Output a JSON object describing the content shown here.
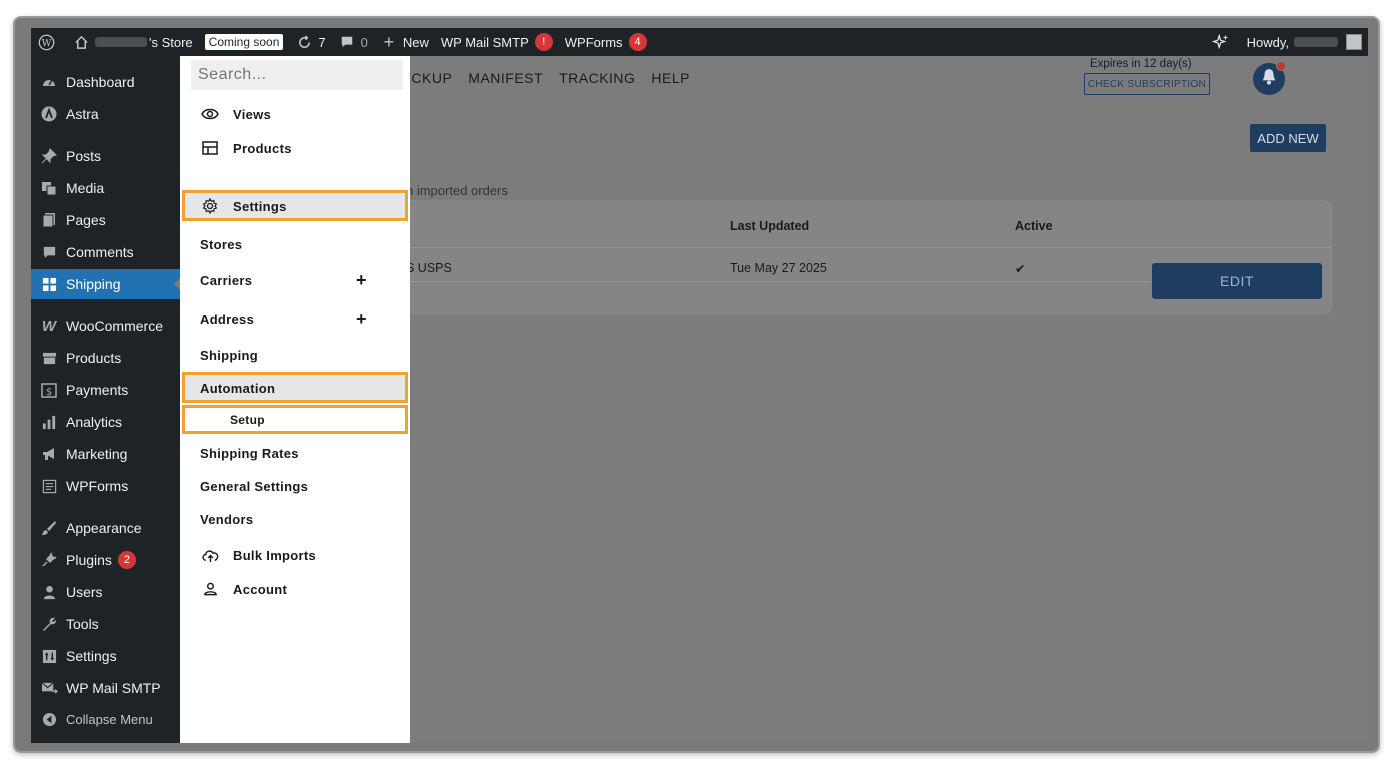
{
  "adminbar": {
    "store_suffix": "'s Store",
    "coming_soon": "Coming soon",
    "updates": "7",
    "comments": "0",
    "new": "New",
    "wp_mail_smtp": "WP Mail SMTP",
    "wp_mail_badge": "!",
    "wpforms": "WPForms",
    "wpforms_badge": "4",
    "howdy": "Howdy,"
  },
  "sidebar": {
    "items": [
      {
        "label": "Dashboard",
        "icon": "dashboard-icon"
      },
      {
        "label": "Astra",
        "icon": "astra-icon"
      },
      {
        "label": "Posts",
        "icon": "pin-icon"
      },
      {
        "label": "Media",
        "icon": "media-icon"
      },
      {
        "label": "Pages",
        "icon": "pages-icon"
      },
      {
        "label": "Comments",
        "icon": "comment-icon"
      },
      {
        "label": "Shipping",
        "icon": "grid-icon"
      },
      {
        "label": "WooCommerce",
        "icon": "woo-icon"
      },
      {
        "label": "Products",
        "icon": "archive-icon"
      },
      {
        "label": "Payments",
        "icon": "dollar-icon"
      },
      {
        "label": "Analytics",
        "icon": "bar-chart-icon"
      },
      {
        "label": "Marketing",
        "icon": "megaphone-icon"
      },
      {
        "label": "WPForms",
        "icon": "form-icon"
      },
      {
        "label": "Appearance",
        "icon": "brush-icon"
      },
      {
        "label": "Plugins",
        "icon": "plug-icon"
      },
      {
        "label": "Users",
        "icon": "user-icon"
      },
      {
        "label": "Tools",
        "icon": "wrench-icon"
      },
      {
        "label": "Settings",
        "icon": "settings-icon"
      },
      {
        "label": "WP Mail SMTP",
        "icon": "mail-icon"
      },
      {
        "label": "Collapse Menu",
        "icon": "collapse-icon"
      }
    ],
    "plugins_badge": "2"
  },
  "main": {
    "nav": [
      "ICKUP",
      "MANIFEST",
      "TRACKING",
      "HELP"
    ],
    "expires": "Expires in 12 day(s)",
    "check_subscription": "CHECK SUBSCRIPTION",
    "add_new": "ADD NEW",
    "note": "n imported orders",
    "table": {
      "headers": [
        "Last Updated",
        "Active"
      ],
      "row": {
        "carrier": "S USPS",
        "last_updated": "Tue May 27 2025",
        "active": "✔"
      }
    },
    "edit": "EDIT"
  },
  "panel": {
    "search_placeholder": "Search...",
    "items": {
      "views": "Views",
      "products": "Products",
      "settings": "Settings",
      "stores": "Stores",
      "carriers": "Carriers",
      "address": "Address",
      "shipping": "Shipping",
      "automation": "Automation",
      "setup": "Setup",
      "shipping_rates": "Shipping Rates",
      "general_settings": "General Settings",
      "vendors": "Vendors",
      "bulk_imports": "Bulk Imports",
      "account": "Account"
    },
    "plus": "+"
  },
  "colors": {
    "highlight": "#f0a132",
    "admin_bg": "#1d2327",
    "active_blue": "#2271b1",
    "navy": "#1f3d60"
  }
}
